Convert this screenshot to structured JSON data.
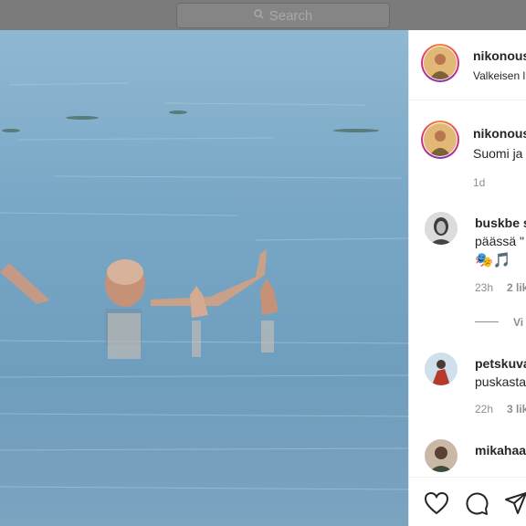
{
  "search": {
    "placeholder": "Search",
    "icon": "search-icon"
  },
  "post": {
    "author": "nikonous",
    "location": "Valkeisen l",
    "caption_author": "nikonous",
    "caption_text": "Suomi ja",
    "caption_time": "1d"
  },
  "comments": [
    {
      "user": "buskbe s",
      "line1": "päässä \"",
      "line2": "🎭🎵",
      "time": "23h",
      "likes": "2 lik"
    },
    {
      "user": "petskuva",
      "line1": "puskasta",
      "time": "22h",
      "likes": "3 lik"
    },
    {
      "user": "mikahaa"
    }
  ],
  "view_replies": "Vi",
  "actions": {
    "like": "heart-icon",
    "comment": "comment-icon",
    "share": "share-icon"
  },
  "colors": {
    "panel_bg": "#ffffff",
    "text": "#262626",
    "muted": "#8e8e8e",
    "story_ring": "#dd2a7b"
  }
}
